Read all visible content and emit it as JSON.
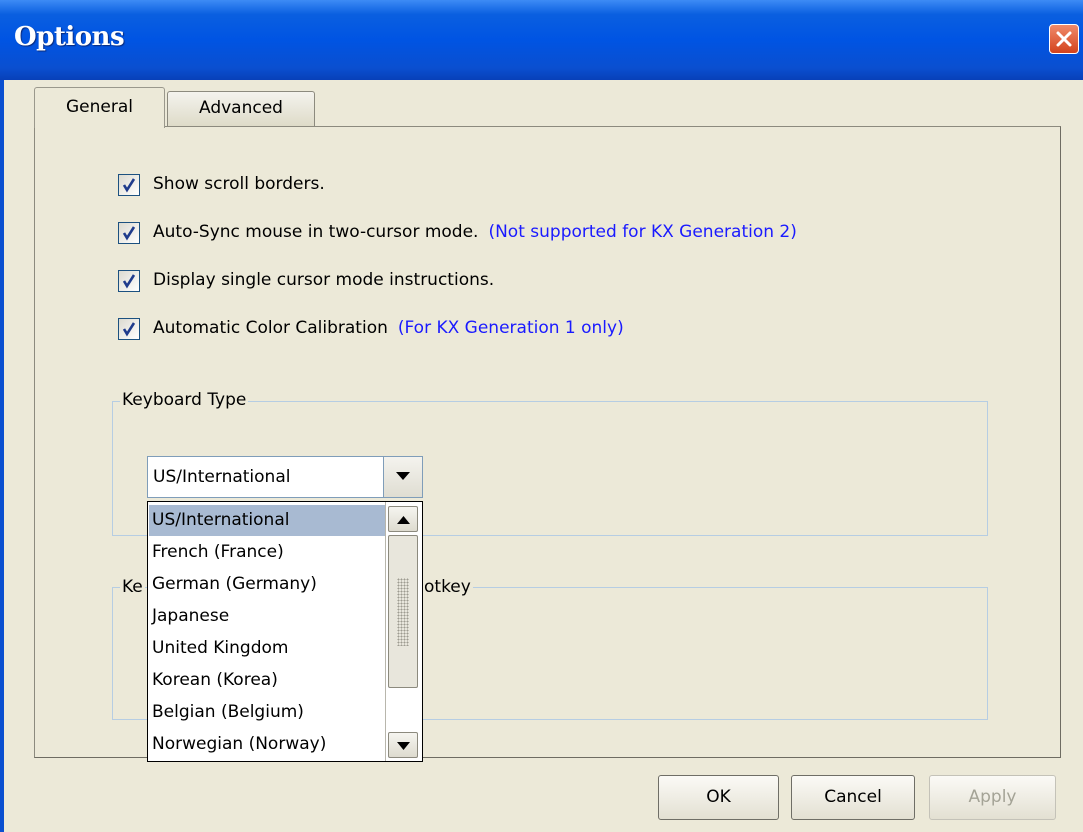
{
  "window": {
    "title": "Options"
  },
  "tabs": [
    {
      "label": "General",
      "active": true
    },
    {
      "label": "Advanced",
      "active": false
    }
  ],
  "checkboxes": [
    {
      "label": "Show scroll borders.",
      "note": "",
      "checked": true
    },
    {
      "label": "Auto-Sync mouse in two-cursor mode.",
      "note": "(Not supported for KX Generation 2)",
      "checked": true
    },
    {
      "label": "Display single cursor mode instructions.",
      "note": "",
      "checked": true
    },
    {
      "label": "Automatic Color Calibration",
      "note": "(For KX Generation 1 only)",
      "checked": true
    }
  ],
  "keyboard_type": {
    "legend": "Keyboard Type",
    "selected": "US/International",
    "options": [
      "US/International",
      "French (France)",
      "German (Germany)",
      "Japanese",
      "United Kingdom",
      "Korean (Korea)",
      "Belgian (Belgium)",
      "Norwegian (Norway)"
    ]
  },
  "hotkey_group": {
    "legend_left": "Ke",
    "legend_right": "otkey"
  },
  "buttons": {
    "ok": "OK",
    "cancel": "Cancel",
    "apply": "Apply"
  },
  "colors": {
    "titlebar": "#0054e3",
    "note_text": "#1a1aff",
    "selection": "#a8bad2"
  },
  "icons": {
    "close": "close-icon",
    "checkmark": "checkmark-icon",
    "dropdown": "chevron-down-icon"
  }
}
